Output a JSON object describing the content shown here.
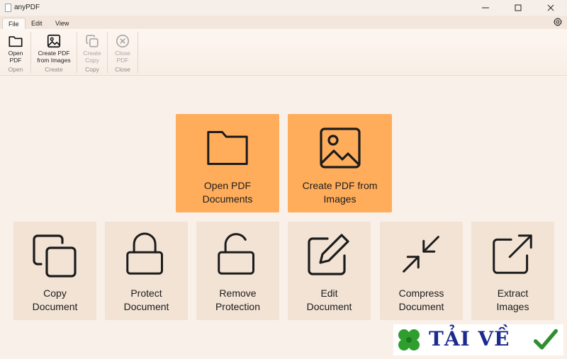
{
  "window": {
    "title": "anyPDF"
  },
  "menu": {
    "tabs": [
      "File",
      "Edit",
      "View"
    ],
    "active_tab": "File"
  },
  "ribbon": {
    "groups": [
      {
        "label": "Open",
        "buttons": [
          {
            "label": "Open\nPDF",
            "enabled": true
          }
        ]
      },
      {
        "label": "Create",
        "buttons": [
          {
            "label": "Create PDF\nfrom Images",
            "enabled": true
          }
        ]
      },
      {
        "label": "Copy",
        "buttons": [
          {
            "label": "Create\nCopy",
            "enabled": false
          }
        ]
      },
      {
        "label": "Close",
        "buttons": [
          {
            "label": "Close\nPDF",
            "enabled": false
          }
        ]
      }
    ]
  },
  "cards": {
    "primary": [
      {
        "label": "Open PDF\nDocuments",
        "icon": "folder-icon"
      },
      {
        "label": "Create PDF from\nImages",
        "icon": "image-icon"
      }
    ],
    "secondary": [
      {
        "label": "Copy\nDocument",
        "icon": "copy-icon"
      },
      {
        "label": "Protect\nDocument",
        "icon": "lock-icon"
      },
      {
        "label": "Remove\nProtection",
        "icon": "unlock-icon"
      },
      {
        "label": "Edit\nDocument",
        "icon": "edit-icon"
      },
      {
        "label": "Compress\nDocument",
        "icon": "compress-icon"
      },
      {
        "label": "Extract\nImages",
        "icon": "export-icon"
      }
    ]
  },
  "watermark": {
    "text": "TẢI VỀ"
  },
  "colors": {
    "primary_card": "#ffad5b",
    "secondary_card": "#f2e3d5",
    "background": "#f9f0e9"
  }
}
